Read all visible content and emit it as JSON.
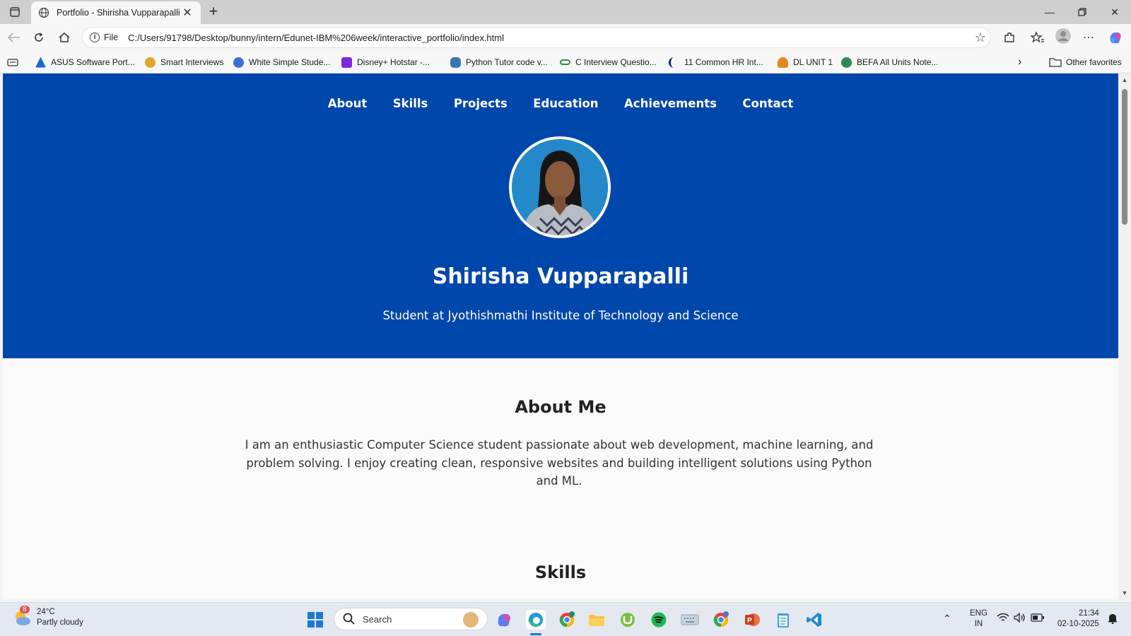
{
  "browser": {
    "tab_title": "Portfolio - Shirisha Vupparapalli",
    "new_tab": "+",
    "url_scheme": "File",
    "url": "C:/Users/91798/Desktop/bunny/intern/Edunet-IBM%206week/interactive_portfolio/index.html",
    "favorites": [
      {
        "label": "ASUS Software Port...",
        "color": "#1e66d0"
      },
      {
        "label": "Smart Interviews",
        "color": "#e0a52a"
      },
      {
        "label": "White Simple Stude...",
        "color": "#3b6fd8"
      },
      {
        "label": "Disney+ Hotstar -...",
        "color": "#7b2bd6"
      },
      {
        "label": "Python Tutor code v...",
        "color": "#3c77b2"
      },
      {
        "label": "C Interview Questio...",
        "color": "#2b8f43"
      },
      {
        "label": "11 Common HR Int...",
        "color": "#0c2a6b"
      },
      {
        "label": "DL UNIT 1",
        "color": "#e08a1e"
      },
      {
        "label": "BEFA All Units Note...",
        "color": "#2f8a57"
      }
    ],
    "other_favorites": "Other favorites"
  },
  "page": {
    "nav": [
      "About",
      "Skills",
      "Projects",
      "Education",
      "Achievements",
      "Contact"
    ],
    "name": "Shirisha Vupparapalli",
    "subtitle": "Student at Jyothishmathi Institute of Technology and Science",
    "about_title": "About Me",
    "about_text": "I am an enthusiastic Computer Science student passionate about web development, machine learning, and problem solving. I enjoy creating clean, responsive websites and building intelligent solutions using Python and ML.",
    "skills_title": "Skills",
    "hero_color": "#0047ab"
  },
  "taskbar": {
    "weather_temp": "24°C",
    "weather_desc": "Partly cloudy",
    "weather_badge": "8",
    "search_placeholder": "Search",
    "lang_line1": "ENG",
    "lang_line2": "IN",
    "time": "21:34",
    "date": "02-10-2025"
  }
}
